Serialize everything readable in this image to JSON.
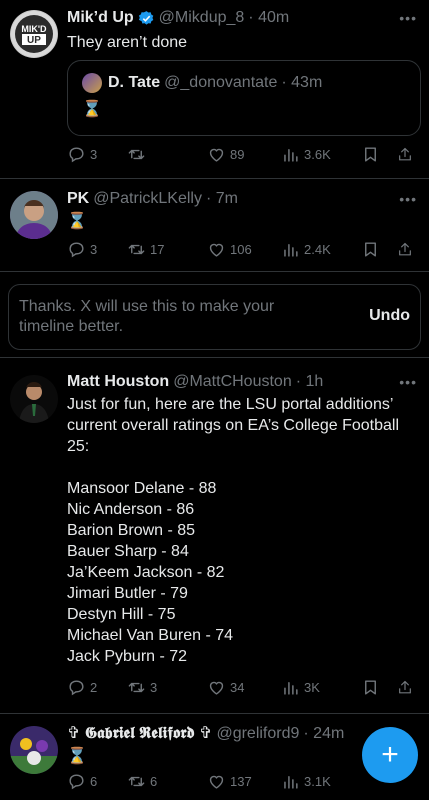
{
  "colors": {
    "background": "#000000",
    "text": "#e7e9ea",
    "secondary": "#71767b",
    "accent": "#1d9bf0",
    "border": "#2f3336"
  },
  "tweets": [
    {
      "name": "Mik’d Up",
      "handle": "@Mikdup_8",
      "time": "· 40m",
      "verified": true,
      "text": "They aren’t done",
      "quote": {
        "name": "D. Tate",
        "handle": "@_donovantate",
        "time": "· 43m",
        "text": "⌛"
      },
      "stats": {
        "replies": "3",
        "retweets": "",
        "likes": "89",
        "views": "3.6K"
      }
    },
    {
      "name": "PK",
      "handle": "@PatrickLKelly",
      "time": "· 7m",
      "text": "⌛",
      "stats": {
        "replies": "3",
        "retweets": "17",
        "likes": "106",
        "views": "2.4K"
      }
    },
    {
      "name": "Matt Houston",
      "handle": "@MattCHouston",
      "time": "· 1h",
      "text_lines": [
        "Just for fun, here are the LSU portal additions’",
        "current overall ratings on EA’s College Football",
        "25:",
        "",
        "Mansoor Delane - 88",
        "Nic Anderson - 86",
        "Barion Brown - 85",
        "Bauer Sharp - 84",
        "Ja’Keem Jackson - 82",
        "Jimari Butler - 79",
        "Destyn Hill - 75",
        "Michael Van Buren - 74",
        "Jack Pyburn - 72"
      ],
      "stats": {
        "replies": "2",
        "retweets": "3",
        "likes": "34",
        "views": "3K"
      }
    },
    {
      "name": "✞ 𝕲𝖆𝖇𝖗𝖎𝖊𝖑 𝕽𝖊𝖑𝖎𝖋𝖔𝖗𝖉 ✞",
      "handle": "@greliford9",
      "time": "· 24m",
      "text": "⌛",
      "stats": {
        "replies": "6",
        "retweets": "6",
        "likes": "137",
        "views": "3.1K"
      }
    }
  ],
  "notice": {
    "text": "Thanks. X will use this to make your timeline better.",
    "undo": "Undo"
  },
  "avatar_text": {
    "mikdup_top": "MIK'D",
    "mikdup_bottom": "UP"
  },
  "more_label": "•••",
  "fab_label": "+"
}
